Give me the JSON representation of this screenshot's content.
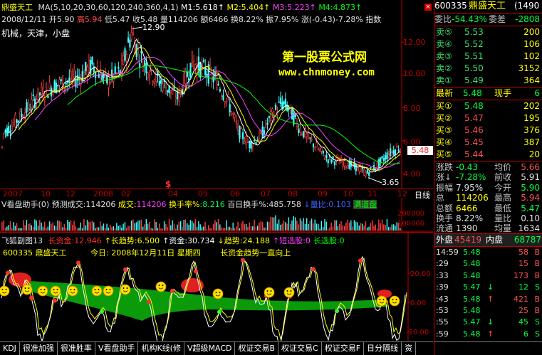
{
  "header": {
    "stock_name": "鼎盛天工",
    "ma_label": "MA(5,10,20,30,60,120,240,360,4,1)",
    "ma_values": [
      {
        "label": "M1:",
        "value": "5.618"
      },
      {
        "label": "M2:",
        "value": "5.404"
      },
      {
        "label": "M3:",
        "value": "5.223"
      },
      {
        "label": "M4:",
        "value": "4.873"
      }
    ],
    "arrow_up": "↑",
    "colors": {
      "m1": "#ffffff",
      "m2": "#ffff00",
      "m3": "#ff40ff",
      "m4": "#00ff00"
    }
  },
  "quote_line": {
    "date": "2008/12/11",
    "open": "开5.90",
    "high": "高5.94",
    "low": "低5.47",
    "close": "收5.48",
    "vol": "量114206",
    "amount": "额6466",
    "turnover": "换8.22%",
    "amplitude": "振7.95%",
    "change": "涨(-0.43)-7.28%",
    "indicator": "指数"
  },
  "sector": "机械，天津，小盘",
  "watermark": {
    "line1": "第一股票公式网",
    "line2": "www.chnmoney.com"
  },
  "price_axis": [
    "12.00",
    "10.00",
    "8.00",
    "6.00",
    "4.00"
  ],
  "price_axis_values": [
    12,
    10,
    8,
    6,
    4
  ],
  "current_price_label": "5.48",
  "high_marker": "12.90",
  "low_marker": "3.65",
  "date_axis": [
    "2007",
    "10",
    "12",
    "2008",
    "02",
    "04",
    "05",
    "06",
    "07",
    "08",
    "09",
    "10",
    "11",
    "12"
  ],
  "period_label": "日线",
  "dollar_marker": "$",
  "volume_panel": {
    "title": "V看盘助手(0)",
    "forecast_label": "预测成交:",
    "forecast_value": "114206",
    "done_label": "成交:",
    "done_value": "114206",
    "turnover_label": "换手率%",
    "turnover_value": ":8.216",
    "hundred_label": "百日换手%:",
    "hundred_value": "485.758",
    "ratio_label": "↓量比",
    "ratio_value": ":0.103",
    "status": "满道盘",
    "axis": [
      "200000",
      "100000"
    ],
    "axis_values": [
      200000,
      100000
    ]
  },
  "osc_panel": {
    "title": "飞狐副图13",
    "items": [
      {
        "label": "长资金",
        "value": ":12.946",
        "color": "#ff3030"
      },
      {
        "label": "↑长趋势",
        "value": ":6.500",
        "color": "#ffff00"
      },
      {
        "label": "↑资金",
        "value": ":30.734",
        "color": "#ffffff"
      },
      {
        "label": "↓趋势",
        "value": ":24.188",
        "color": "#ffff00"
      },
      {
        "label": "↑短选股",
        "value": ":0",
        "color": "#ff40ff"
      },
      {
        "label": "长选股",
        "value": ":0",
        "color": "#00ff00"
      }
    ],
    "code_name": "600335 鼎盛天工",
    "today_label": "今日:",
    "today_date": "2008年12月11日",
    "weekday": "星期四",
    "note": "长资金趋势一直向上",
    "axis": [
      "20.00",
      "0.00",
      "-20.00"
    ],
    "axis_values": [
      20,
      0,
      -20
    ]
  },
  "tabs": [
    "KDJ",
    "很准加强",
    "很准胜率",
    "V看盘助手",
    "机构K线(修",
    "V超级MACD",
    "权证交易B",
    "权证交易C",
    "权证交易F",
    "日分隔线",
    "资"
  ],
  "right_panel": {
    "code": "600335",
    "name": "鼎盛天工",
    "extra": "(1490",
    "weibi_label": "委比",
    "weibi_value": "-54.43%",
    "weicha_label": "委差",
    "weicha_value": "-2808",
    "asks": [
      {
        "label": "卖⑤",
        "price": "5.53",
        "vol": "200"
      },
      {
        "label": "卖④",
        "price": "5.52",
        "vol": "106"
      },
      {
        "label": "卖③",
        "price": "5.51",
        "vol": "102"
      },
      {
        "label": "卖②",
        "price": "5.50",
        "vol": "3152"
      },
      {
        "label": "卖①",
        "price": "5.49",
        "vol": "364"
      }
    ],
    "latest_label": "最新",
    "latest_value": "5.48",
    "xianshou_label": "现手",
    "xianshou_value": "6",
    "bids": [
      {
        "label": "买①",
        "price": "5.48",
        "vol": "202"
      },
      {
        "label": "买②",
        "price": "5.47",
        "vol": "195"
      },
      {
        "label": "买③",
        "price": "5.46",
        "vol": "376"
      },
      {
        "label": "买④",
        "price": "5.45",
        "vol": "387"
      },
      {
        "label": "买⑤",
        "price": "5.44",
        "vol": "20"
      }
    ],
    "stats": [
      {
        "l1": "涨跌",
        "v1": "-0.43",
        "l2": "均价",
        "v2": "5.66",
        "c1": "green",
        "c2": "red"
      },
      {
        "l1": "涨↓",
        "v1": "-7.28%",
        "l2": "前收",
        "v2": "5.91",
        "c1": "green",
        "c2": "white"
      },
      {
        "l1": "振幅",
        "v1": "7.95%",
        "l2": "今开",
        "v2": "5.90",
        "c1": "white",
        "c2": "green"
      },
      {
        "l1": "总",
        "v1": "114206",
        "l2": "最高",
        "v2": "5.94",
        "c1": "yellow",
        "c2": "red"
      },
      {
        "l1": "总额",
        "v1": "6466",
        "l2": "最低",
        "v2": "5.47",
        "c1": "yellow",
        "c2": "green"
      },
      {
        "l1": "换手",
        "v1": "8.22%",
        "l2": "量比",
        "v2": "0.10",
        "c1": "white",
        "c2": "white"
      },
      {
        "l1": "流通",
        "v1": "1390",
        "l2": "均量",
        "v2": "1634",
        "c1": "white",
        "c2": "white"
      }
    ],
    "outer_label": "外盘",
    "outer_value": "45419",
    "inner_label": "内盘",
    "inner_value": "68787",
    "ticks": [
      {
        "time": "14:59",
        "price": "5.48",
        "arrow": "",
        "vol": "58",
        "bs": "B"
      },
      {
        "time": ":29",
        "price": "5.48",
        "arrow": "",
        "vol": "15",
        "bs": "B"
      },
      {
        "time": ":33",
        "price": "5.48",
        "arrow": "",
        "vol": "173",
        "bs": "B"
      },
      {
        "time": ":39",
        "price": "5.47",
        "arrow": "↓",
        "vol": "12",
        "bs": "S"
      },
      {
        "time": ":43",
        "price": "5.48",
        "arrow": "↑",
        "vol": "421",
        "bs": "B"
      },
      {
        "time": ":53",
        "price": "5.48",
        "arrow": "",
        "vol": "25",
        "bs": "B"
      },
      {
        "time": ":55",
        "price": "5.47",
        "arrow": "↓",
        "vol": "45",
        "bs": "S"
      },
      {
        "time": ":59",
        "price": "5.48",
        "arrow": "↑",
        "vol": "6",
        "bs": "S"
      }
    ]
  }
}
